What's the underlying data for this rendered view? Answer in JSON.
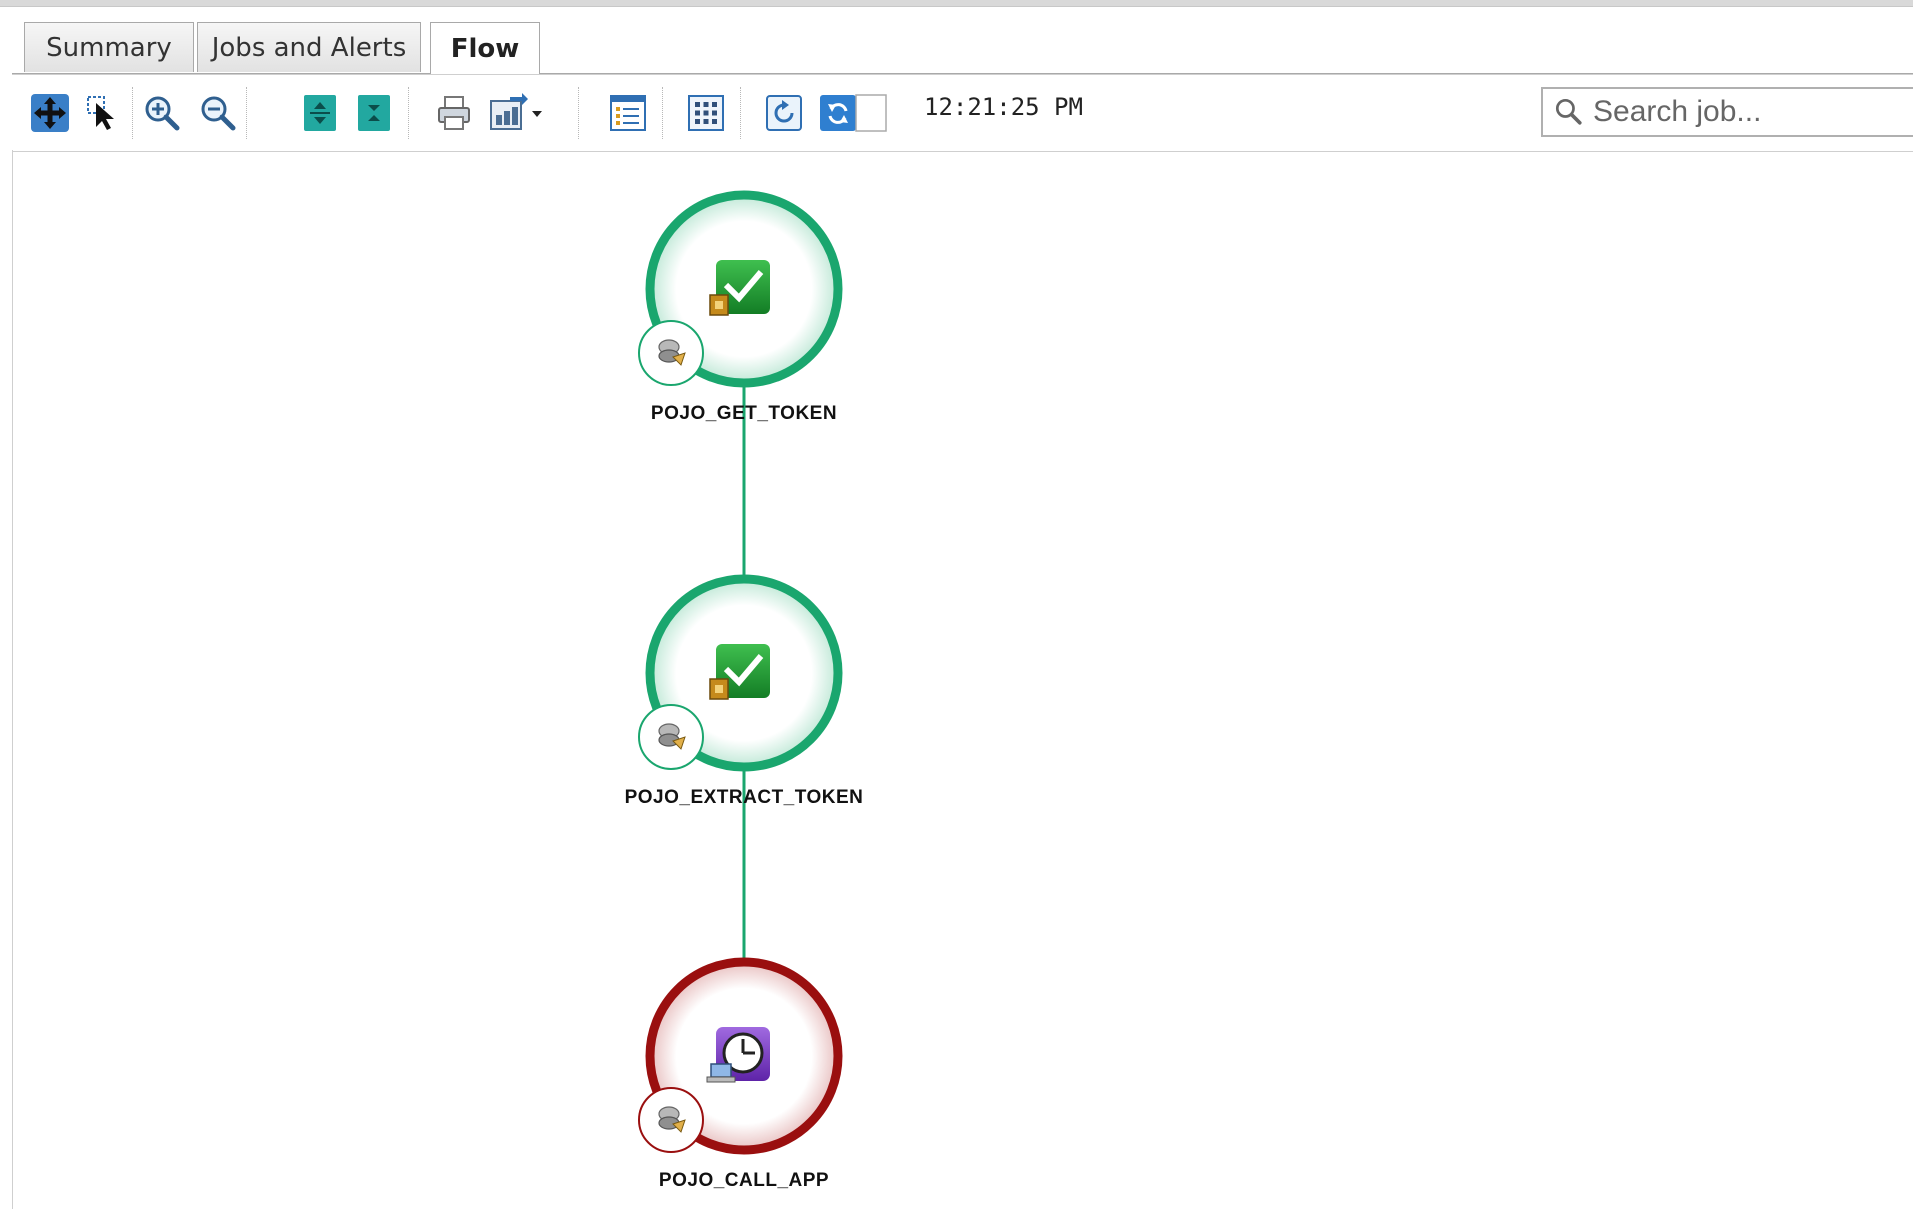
{
  "tabs": [
    {
      "label": "Summary",
      "active": false
    },
    {
      "label": "Jobs and Alerts",
      "active": false
    },
    {
      "label": "Flow",
      "active": true
    }
  ],
  "toolbar": {
    "buttons": [
      "pan-icon",
      "select-icon",
      "zoom-in-icon",
      "zoom-out-icon",
      "expand-vertical-icon",
      "collapse-vertical-icon",
      "print-icon",
      "export-icon",
      "list-view-icon",
      "grid-view-icon",
      "refresh-icon",
      "auto-refresh-icon"
    ],
    "time": "12:21:25 PM"
  },
  "search": {
    "placeholder": "Search job..."
  },
  "flow": {
    "nodes": [
      {
        "name": "POJO_GET_TOKEN",
        "status": "success",
        "ring_color": "#1aa66e",
        "icon": "checkmark-job-icon"
      },
      {
        "name": "POJO_EXTRACT_TOKEN",
        "status": "success",
        "ring_color": "#1aa66e",
        "icon": "checkmark-job-icon"
      },
      {
        "name": "POJO_CALL_APP",
        "status": "waiting",
        "ring_color": "#9a0f0f",
        "icon": "clock-job-icon"
      }
    ],
    "edge_color": "#1aa66e"
  }
}
